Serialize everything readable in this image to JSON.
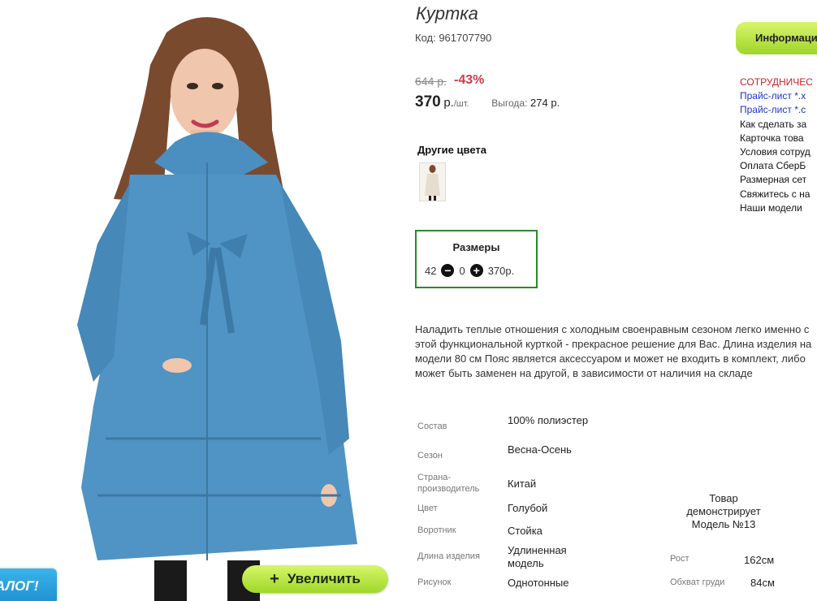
{
  "product": {
    "title": "Куртка",
    "code": "Код: 961707790",
    "old_price": "644 р.",
    "discount": "-43%",
    "price": "370",
    "price_currency": "р.",
    "price_unit": "/шт.",
    "benefit_label": "Выгода:",
    "benefit_value": "274 р."
  },
  "other_colors": {
    "title": "Другие цвета"
  },
  "sizes": {
    "title": "Размеры",
    "size": "42",
    "minus_icon": "minus-circle-icon",
    "quantity": "0",
    "plus_icon": "plus-circle-icon",
    "price": "370р."
  },
  "description": "Наладить теплые отношения с холодным своенравным сезоном легко именно с этой функциональной курткой - прекрасное решение для Вас. Длина изделия на модели 80 см Пояс является аксессуаром и может не входить в комплект, либо может быть заменен на другой, в зависимости от наличия на складе",
  "specs": [
    {
      "label": "Состав",
      "value": "100% полиэстер"
    },
    {
      "label": "Сезон",
      "value": "Весна-Осень"
    },
    {
      "label": "Страна-производитель",
      "value": "Китай"
    },
    {
      "label": "Цвет",
      "value": "Голубой"
    },
    {
      "label": "Воротник",
      "value": "Стойка"
    },
    {
      "label": "Длина изделия",
      "value": "Удлиненная модель"
    },
    {
      "label": "Рисунок",
      "value": "Однотонные"
    }
  ],
  "model": {
    "title": "Товар демонстрирует Модель №13",
    "height_label": "Рост",
    "height_value": "162см",
    "chest_label": "Обхват груди",
    "chest_value": "84см"
  },
  "photo": {
    "zoom_label": "Увеличить",
    "zoom_icon": "plus-icon",
    "catalog_tab": "АЛОГ!"
  },
  "info_button": "Информаци",
  "sidebar_links": [
    {
      "text": "СОТРУДНИЧЕС",
      "color": "#d0202a"
    },
    {
      "text": "Прайс-лист *.x",
      "color": "#1d35c8"
    },
    {
      "text": "Прайс-лист *.c",
      "color": "#1d35c8"
    },
    {
      "text": "Как сделать за",
      "color": "#111111"
    },
    {
      "text": "Карточка това",
      "color": "#111111"
    },
    {
      "text": "Условия сотруд",
      "color": "#111111"
    },
    {
      "text": "Оплата СберБ",
      "color": "#111111"
    },
    {
      "text": "Размерная сет",
      "color": "#111111"
    },
    {
      "text": "Свяжитесь с на",
      "color": "#111111"
    },
    {
      "text": "Наши модели",
      "color": "#111111"
    }
  ],
  "colors": {
    "accent_green": "#9ed52a",
    "discount_red": "#d63a4a",
    "sizes_border": "#2a8a2a",
    "jacket_blue": "#4a8fbf"
  }
}
